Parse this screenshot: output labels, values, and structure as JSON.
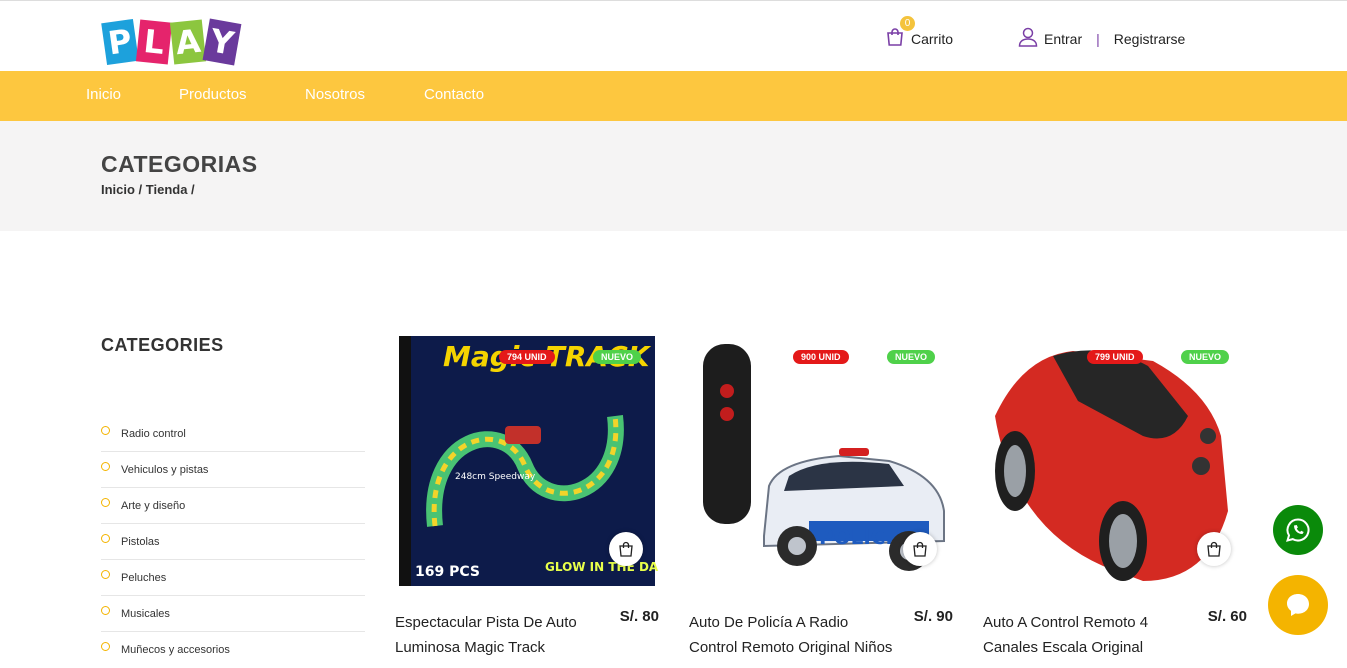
{
  "brand": {
    "logo_letters": [
      "P",
      "L",
      "A",
      "Y"
    ]
  },
  "header": {
    "cart_label": "Carrito",
    "cart_count": "0",
    "login_label": "Entrar",
    "separator": "|",
    "register_label": "Registrarse"
  },
  "nav": {
    "items": [
      "Inicio",
      "Productos",
      "Nosotros",
      "Contacto"
    ]
  },
  "banner": {
    "title": "CATEGORIAS",
    "breadcrumb": "Inicio / Tienda /"
  },
  "sidebar": {
    "title": "CATEGORIES",
    "categories": [
      "Radio control",
      "Vehiculos y pistas",
      "Arte y diseño",
      "Pistolas",
      "Peluches",
      "Musicales",
      "Muñecos y accesorios"
    ]
  },
  "products": [
    {
      "stock": "794 UNID",
      "badge": "NUEVO",
      "title": "Espectacular Pista De Auto Luminosa Magic Track",
      "price": "S/. 80"
    },
    {
      "stock": "900 UNID",
      "badge": "NUEVO",
      "title": "Auto De Policía A Radio Control Remoto Original Niños",
      "price": "S/. 90"
    },
    {
      "stock": "799 UNID",
      "badge": "NUEVO",
      "title": "Auto A Control Remoto 4 Canales Escala Original",
      "price": "S/. 60"
    }
  ],
  "product_images": {
    "p1": {
      "box_text": "Magic TRACK",
      "length_text": "248cm Speedway",
      "pieces_text": "169 PCS",
      "tagline": "GLOW IN THE DARK"
    },
    "p2": {
      "car_text": "POLICE"
    }
  },
  "colors": {
    "nav": "#fdc73f",
    "accent": "#7a3fa6",
    "stock_badge": "#e41919",
    "new_badge": "#4fd14a",
    "whatsapp": "#0a8a0a",
    "chat": "#f4b400"
  }
}
